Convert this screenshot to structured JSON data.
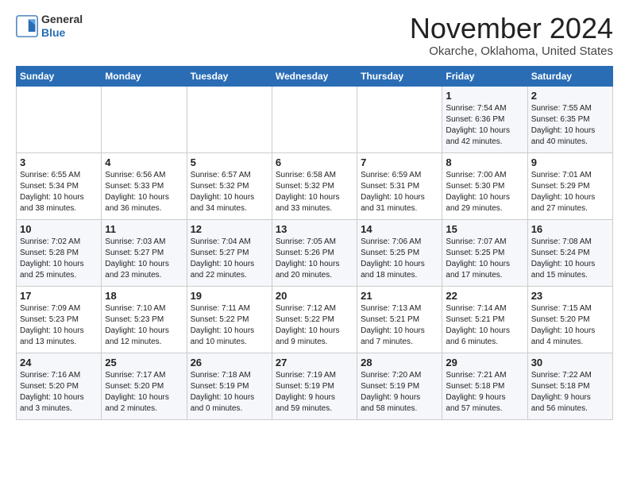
{
  "logo": {
    "general": "General",
    "blue": "Blue"
  },
  "header": {
    "month": "November 2024",
    "location": "Okarche, Oklahoma, United States"
  },
  "weekdays": [
    "Sunday",
    "Monday",
    "Tuesday",
    "Wednesday",
    "Thursday",
    "Friday",
    "Saturday"
  ],
  "weeks": [
    [
      {
        "day": "",
        "info": ""
      },
      {
        "day": "",
        "info": ""
      },
      {
        "day": "",
        "info": ""
      },
      {
        "day": "",
        "info": ""
      },
      {
        "day": "",
        "info": ""
      },
      {
        "day": "1",
        "info": "Sunrise: 7:54 AM\nSunset: 6:36 PM\nDaylight: 10 hours\nand 42 minutes."
      },
      {
        "day": "2",
        "info": "Sunrise: 7:55 AM\nSunset: 6:35 PM\nDaylight: 10 hours\nand 40 minutes."
      }
    ],
    [
      {
        "day": "3",
        "info": "Sunrise: 6:55 AM\nSunset: 5:34 PM\nDaylight: 10 hours\nand 38 minutes."
      },
      {
        "day": "4",
        "info": "Sunrise: 6:56 AM\nSunset: 5:33 PM\nDaylight: 10 hours\nand 36 minutes."
      },
      {
        "day": "5",
        "info": "Sunrise: 6:57 AM\nSunset: 5:32 PM\nDaylight: 10 hours\nand 34 minutes."
      },
      {
        "day": "6",
        "info": "Sunrise: 6:58 AM\nSunset: 5:32 PM\nDaylight: 10 hours\nand 33 minutes."
      },
      {
        "day": "7",
        "info": "Sunrise: 6:59 AM\nSunset: 5:31 PM\nDaylight: 10 hours\nand 31 minutes."
      },
      {
        "day": "8",
        "info": "Sunrise: 7:00 AM\nSunset: 5:30 PM\nDaylight: 10 hours\nand 29 minutes."
      },
      {
        "day": "9",
        "info": "Sunrise: 7:01 AM\nSunset: 5:29 PM\nDaylight: 10 hours\nand 27 minutes."
      }
    ],
    [
      {
        "day": "10",
        "info": "Sunrise: 7:02 AM\nSunset: 5:28 PM\nDaylight: 10 hours\nand 25 minutes."
      },
      {
        "day": "11",
        "info": "Sunrise: 7:03 AM\nSunset: 5:27 PM\nDaylight: 10 hours\nand 23 minutes."
      },
      {
        "day": "12",
        "info": "Sunrise: 7:04 AM\nSunset: 5:27 PM\nDaylight: 10 hours\nand 22 minutes."
      },
      {
        "day": "13",
        "info": "Sunrise: 7:05 AM\nSunset: 5:26 PM\nDaylight: 10 hours\nand 20 minutes."
      },
      {
        "day": "14",
        "info": "Sunrise: 7:06 AM\nSunset: 5:25 PM\nDaylight: 10 hours\nand 18 minutes."
      },
      {
        "day": "15",
        "info": "Sunrise: 7:07 AM\nSunset: 5:25 PM\nDaylight: 10 hours\nand 17 minutes."
      },
      {
        "day": "16",
        "info": "Sunrise: 7:08 AM\nSunset: 5:24 PM\nDaylight: 10 hours\nand 15 minutes."
      }
    ],
    [
      {
        "day": "17",
        "info": "Sunrise: 7:09 AM\nSunset: 5:23 PM\nDaylight: 10 hours\nand 13 minutes."
      },
      {
        "day": "18",
        "info": "Sunrise: 7:10 AM\nSunset: 5:23 PM\nDaylight: 10 hours\nand 12 minutes."
      },
      {
        "day": "19",
        "info": "Sunrise: 7:11 AM\nSunset: 5:22 PM\nDaylight: 10 hours\nand 10 minutes."
      },
      {
        "day": "20",
        "info": "Sunrise: 7:12 AM\nSunset: 5:22 PM\nDaylight: 10 hours\nand 9 minutes."
      },
      {
        "day": "21",
        "info": "Sunrise: 7:13 AM\nSunset: 5:21 PM\nDaylight: 10 hours\nand 7 minutes."
      },
      {
        "day": "22",
        "info": "Sunrise: 7:14 AM\nSunset: 5:21 PM\nDaylight: 10 hours\nand 6 minutes."
      },
      {
        "day": "23",
        "info": "Sunrise: 7:15 AM\nSunset: 5:20 PM\nDaylight: 10 hours\nand 4 minutes."
      }
    ],
    [
      {
        "day": "24",
        "info": "Sunrise: 7:16 AM\nSunset: 5:20 PM\nDaylight: 10 hours\nand 3 minutes."
      },
      {
        "day": "25",
        "info": "Sunrise: 7:17 AM\nSunset: 5:20 PM\nDaylight: 10 hours\nand 2 minutes."
      },
      {
        "day": "26",
        "info": "Sunrise: 7:18 AM\nSunset: 5:19 PM\nDaylight: 10 hours\nand 0 minutes."
      },
      {
        "day": "27",
        "info": "Sunrise: 7:19 AM\nSunset: 5:19 PM\nDaylight: 9 hours\nand 59 minutes."
      },
      {
        "day": "28",
        "info": "Sunrise: 7:20 AM\nSunset: 5:19 PM\nDaylight: 9 hours\nand 58 minutes."
      },
      {
        "day": "29",
        "info": "Sunrise: 7:21 AM\nSunset: 5:18 PM\nDaylight: 9 hours\nand 57 minutes."
      },
      {
        "day": "30",
        "info": "Sunrise: 7:22 AM\nSunset: 5:18 PM\nDaylight: 9 hours\nand 56 minutes."
      }
    ]
  ]
}
